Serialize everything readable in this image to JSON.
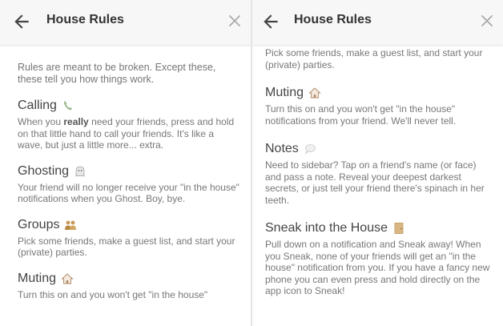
{
  "panels": {
    "left": {
      "title": "House Rules",
      "intro": "Rules are meant to be broken. Except these, these tell you how things work.",
      "calling": {
        "title": "Calling",
        "icon": "phone-icon",
        "pre": "When you ",
        "bold": "really",
        "post": " need your friends, press and hold on that little hand to call your friends. It's like a wave, but just a little more... extra."
      },
      "ghosting": {
        "title": "Ghosting",
        "icon": "ghost-icon",
        "text": "Your friend will no longer receive your \"in the house\" notifications when you Ghost. Boy, bye."
      },
      "groups": {
        "title": "Groups",
        "icon": "group-icon",
        "text": "Pick some friends, make a guest list, and start your (private) parties."
      },
      "muting": {
        "title": "Muting",
        "icon": "house-icon",
        "text": "Turn this on and you won't get \"in the house\""
      }
    },
    "right": {
      "title": "House Rules",
      "groups_tail": "Pick some friends, make a guest list, and start your (private) parties.",
      "muting": {
        "title": "Muting",
        "icon": "house-icon",
        "text": "Turn this on and you won't get \"in the house\" notifications from your friend. We'll never tell."
      },
      "notes": {
        "title": "Notes",
        "icon": "speech-bubble-icon",
        "text": "Need to sidebar? Tap on a friend's name (or face) and pass a note. Reveal your deepest darkest secrets, or just tell your friend there's spinach in her teeth."
      },
      "sneak": {
        "title": "Sneak into the House",
        "icon": "door-icon",
        "text": "Pull down on a notification and Sneak away! When you Sneak, none of your friends will get an \"in the house\" notification from you. If you have a fancy new phone you can even press and hold directly on the app icon to Sneak!"
      }
    }
  }
}
